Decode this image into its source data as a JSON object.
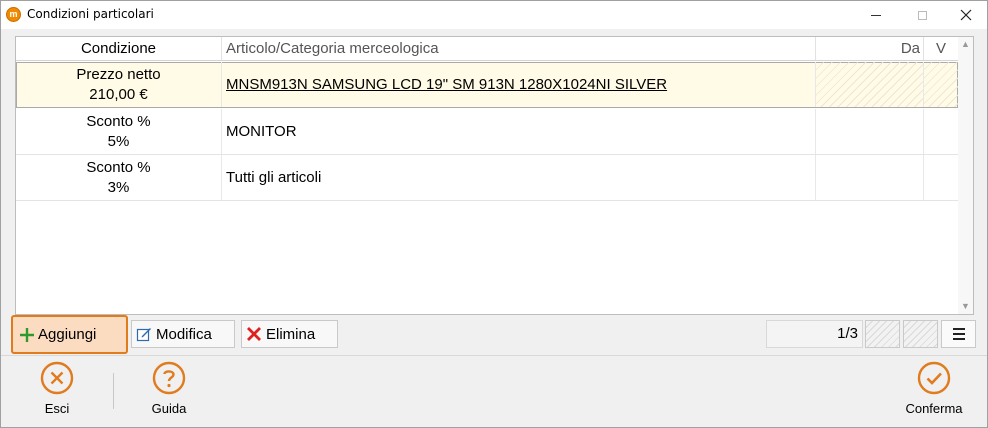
{
  "window": {
    "title": "Condizioni particolari",
    "app_icon_letter": "m"
  },
  "grid": {
    "columns": {
      "condition": "Condizione",
      "article": "Articolo/Categoria merceologica",
      "from": "Da",
      "to": "V"
    },
    "rows": [
      {
        "cond_line1": "Prezzo netto",
        "cond_line2": "210,00 €",
        "article": "MNSM913N SAMSUNG LCD 19\" SM 913N 1280X1024NI SILVER",
        "selected": true
      },
      {
        "cond_line1": "Sconto %",
        "cond_line2": "5%",
        "article": "MONITOR",
        "selected": false
      },
      {
        "cond_line1": "Sconto %",
        "cond_line2": "3%",
        "article": "Tutti gli articoli",
        "selected": false
      }
    ]
  },
  "toolbar": {
    "add_label": "Aggiungi",
    "edit_label": "Modifica",
    "delete_label": "Elimina",
    "pager": "1/3"
  },
  "actions": {
    "exit_label": "Esci",
    "help_label": "Guida",
    "confirm_label": "Conferma"
  },
  "colors": {
    "accent": "#e07b1e",
    "selected_row": "#fffbe6",
    "add_bg": "#fbdcc0",
    "delete_red": "#e02020",
    "add_green": "#2e9a2e"
  }
}
